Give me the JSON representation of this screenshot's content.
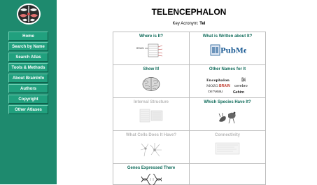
{
  "header": {
    "title": "TELENCEPHALON",
    "acronym_label": "Key Acronym:",
    "acronym_value": "Tel"
  },
  "sidebar": {
    "items": [
      {
        "label": "Home"
      },
      {
        "label": "Search by Name"
      },
      {
        "label": "Search Atlas"
      },
      {
        "label": "Tools & Methods"
      },
      {
        "label": "About BrainInfo"
      },
      {
        "label": "Authors"
      },
      {
        "label": "Copyright"
      },
      {
        "label": "Other Atlases"
      }
    ]
  },
  "grid": {
    "where": {
      "title": "Where is It?",
      "thumb_label": "BRAIN"
    },
    "written": {
      "title": "What is Written about It?",
      "logo_text": "PubMed"
    },
    "show": {
      "title": "Show It!"
    },
    "names": {
      "title": "Other Names for It",
      "words": [
        "Encephalon",
        "脳",
        "MOZG",
        "BRAIN",
        "cerebro",
        "cerveau",
        "Gehirn"
      ]
    },
    "internal": {
      "title": "Internal Structure"
    },
    "species": {
      "title": "Which Species Have It?"
    },
    "cells": {
      "title": "What Cells Does It Have?"
    },
    "connectivity": {
      "title": "Connectivity"
    },
    "genes": {
      "title": "Genes Expressed There"
    }
  },
  "colors": {
    "sidebar_bg": "#1e8a6e",
    "button_bg": "#21a07e",
    "heading": "#0f6b5a",
    "dimmed_heading": "#b8b8b8",
    "pubmed_blue": "#1d5c95"
  }
}
